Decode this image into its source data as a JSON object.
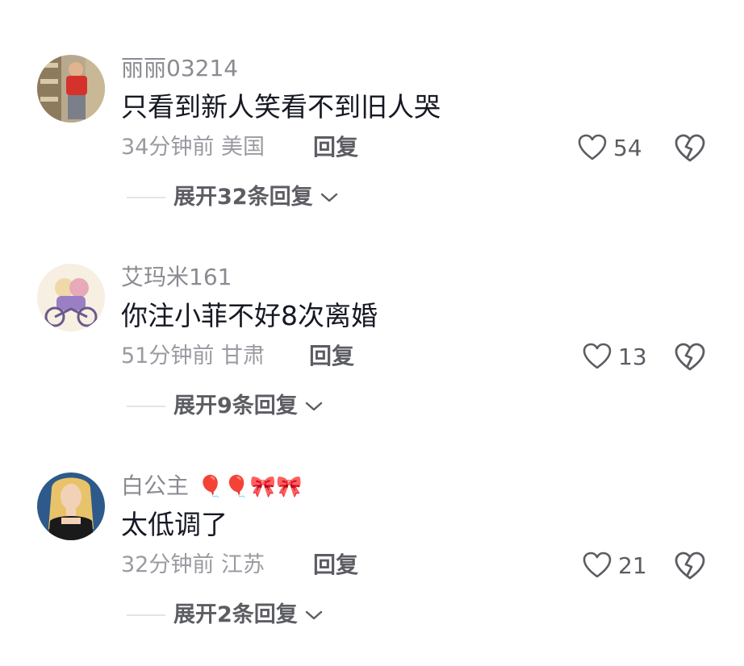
{
  "comments": [
    {
      "username": "丽丽03214",
      "username_emoji": "",
      "text": "只看到新人笑看不到旧人哭",
      "time_location": "34分钟前 美国",
      "reply_label": "回复",
      "likes": "54",
      "expand_label": "展开32条回复",
      "avatar_icon": "boy-in-red-shirt"
    },
    {
      "username": "艾玛米161",
      "username_emoji": "",
      "text": "你注小菲不好8次离婚",
      "time_location": "51分钟前 甘肃",
      "reply_label": "回复",
      "likes": "13",
      "expand_label": "展开9条回复",
      "avatar_icon": "cartoon-bicycle-couple"
    },
    {
      "username": "白公主",
      "username_emoji": "🎈🎈🎀🎀",
      "text": "太低调了",
      "time_location": "32分钟前 江苏",
      "reply_label": "回复",
      "likes": "21",
      "expand_label": "展开2条回复",
      "avatar_icon": "blonde-princess"
    }
  ],
  "colors": {
    "text_primary": "#161823",
    "text_secondary": "#9a9ba1",
    "username": "#8a8b91",
    "action": "#5c5d63"
  }
}
